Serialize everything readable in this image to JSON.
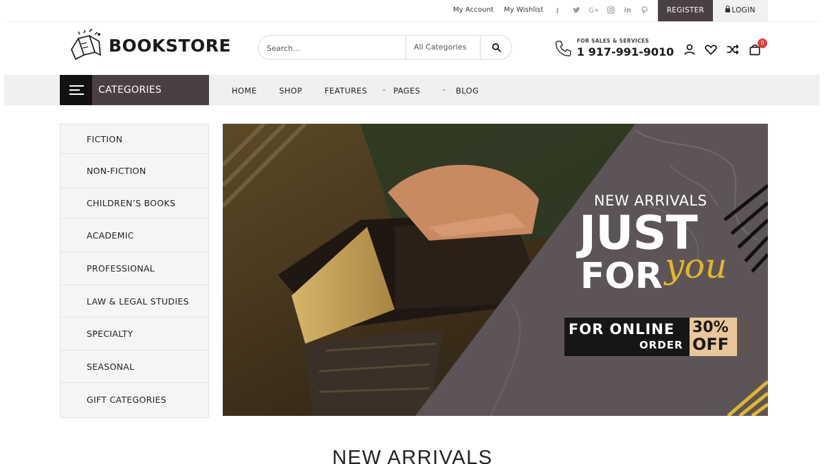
{
  "topbar": {
    "my_account": "My Account",
    "my_wishlist": "My Wishlist",
    "social": [
      "facebook-icon",
      "twitter-icon",
      "google-plus-icon",
      "instagram-icon",
      "linkedin-icon",
      "pinterest-icon"
    ],
    "register": "REGISTER",
    "login": "LOGIN"
  },
  "header": {
    "logo": "BOOKSTORE",
    "search_placeholder": "Search...",
    "search_category": "All Categories",
    "phone_label": "FOR SALES & SERVICES",
    "phone_number": "1 917-991-9010",
    "cart_count": "0"
  },
  "nav": {
    "categories": "CATEGORIES",
    "links": [
      "HOME",
      "SHOP",
      "FEATURES",
      "PAGES",
      "BLOG"
    ]
  },
  "sidebar": {
    "items": [
      "FICTION",
      "NON-FICTION",
      "CHILDREN’S BOOKS",
      "ACADEMIC",
      "PROFESSIONAL",
      "LAW & LEGAL STUDIES",
      "SPECIALTY",
      "SEASONAL",
      "GIFT CATEGORIES"
    ]
  },
  "banner": {
    "subtitle": "NEW ARRIVALS",
    "headline_1": "JUST",
    "headline_2": "FOR",
    "script": "you",
    "offer_line_1": "FOR ONLINE",
    "offer_line_2": "ORDER",
    "discount": "30%",
    "discount_off": "OFF"
  },
  "section": {
    "title": "NEW ARRIVALS"
  },
  "colors": {
    "dark": "#4a4043",
    "accent_yellow": "#e3b62a",
    "badge": "#e63a3a",
    "offer_bg": "#e9c79a"
  }
}
